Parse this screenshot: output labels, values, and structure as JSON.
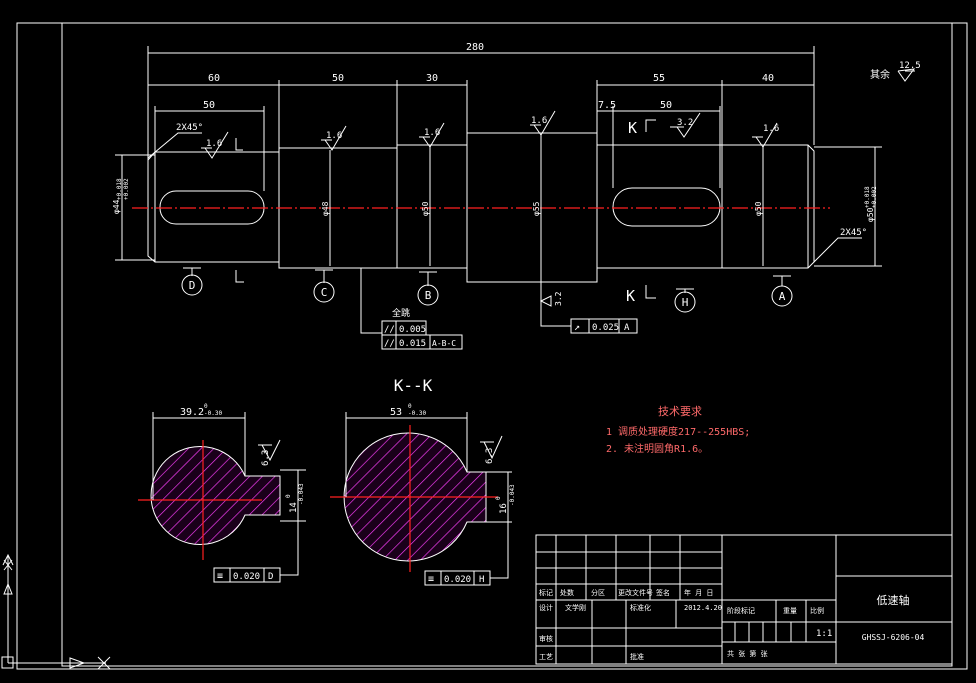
{
  "dims": {
    "overall": "280",
    "seg_left": "60",
    "seg_c": "50",
    "seg_b": "30",
    "seg_h": "55",
    "seg_a": "40",
    "key_left": "50",
    "key_right": "50",
    "offset": "7.5"
  },
  "diameters": {
    "d_left": "φ44",
    "d_c": "φ48",
    "d_b": "φ50",
    "d_mid": "φ55",
    "d_a": "φ50",
    "d_right": "φ50"
  },
  "tol": {
    "left_upper": "+0.018",
    "left_lower": "+0.002",
    "right_upper": "+0.018",
    "right_lower": "+0.002"
  },
  "roughness": {
    "r1": "1.6",
    "r2": "1.6",
    "r3": "1.6",
    "r4": "1.6",
    "r5": "3.2",
    "r6": "1.6",
    "others_label": "其余",
    "others_val": "12.5",
    "shoulder": "3.2"
  },
  "chamfer": {
    "left": "2X45°",
    "right": "2X45°"
  },
  "datums": {
    "d": "D",
    "c": "C",
    "b": "B",
    "h": "H",
    "a": "A"
  },
  "section": {
    "mark": "K",
    "title": "K--K",
    "left_width": "39.2",
    "left_tol": "0",
    "left_tol2": "-0.30",
    "left_key": "14",
    "left_key_tol": "0",
    "left_key_tol2": "-0.043",
    "left_rough": "6.3",
    "left_sym": "≡",
    "left_sym_val": "0.020",
    "left_sym_ref": "D",
    "right_width": "53",
    "right_tol": "0",
    "right_tol2": "-0.30",
    "right_key": "16",
    "right_key_tol": "0",
    "right_key_tol2": "-0.043",
    "right_rough": "6.3",
    "right_sym": "≡",
    "right_sym_val": "0.020",
    "right_sym_ref": "H"
  },
  "gdt": {
    "heading": "全跳",
    "row1_sym": "//",
    "row1_val": "0.005",
    "row2_sym": "//",
    "row2_val": "0.015",
    "row2_ref": "A-B-C",
    "runout_sym": "↗",
    "runout_val": "0.025",
    "runout_ref": "A"
  },
  "notes": {
    "title": "技术要求",
    "line1": "1  调质处理硬度217--255HBS;",
    "line2": "2. 未注明圆角R1.6。"
  },
  "title_block": {
    "part_name": "低速轴",
    "drawing_no": "GHSSJ-6206-04",
    "scale_label": "比例",
    "scale_value": "1:1",
    "weight_label": "重量",
    "stage_label": "阶段标记",
    "sheets": "共 张 第 张",
    "h_mark": "标记",
    "h_count": "处数",
    "h_zone": "分区",
    "h_docno": "更改文件号",
    "h_sign": "签名",
    "h_date": "年 月 日",
    "designer_label": "设计",
    "designer": "文学刚",
    "std_label": "标准化",
    "date": "2012.4.20",
    "review_label": "审核",
    "process_label": "工艺",
    "approve_label": "批准"
  },
  "colors": {
    "background": "#000000",
    "line": "#ffffff",
    "centerline": "#ff2020",
    "hatch": "#ff40ff",
    "notes": "#ff6a6a"
  }
}
